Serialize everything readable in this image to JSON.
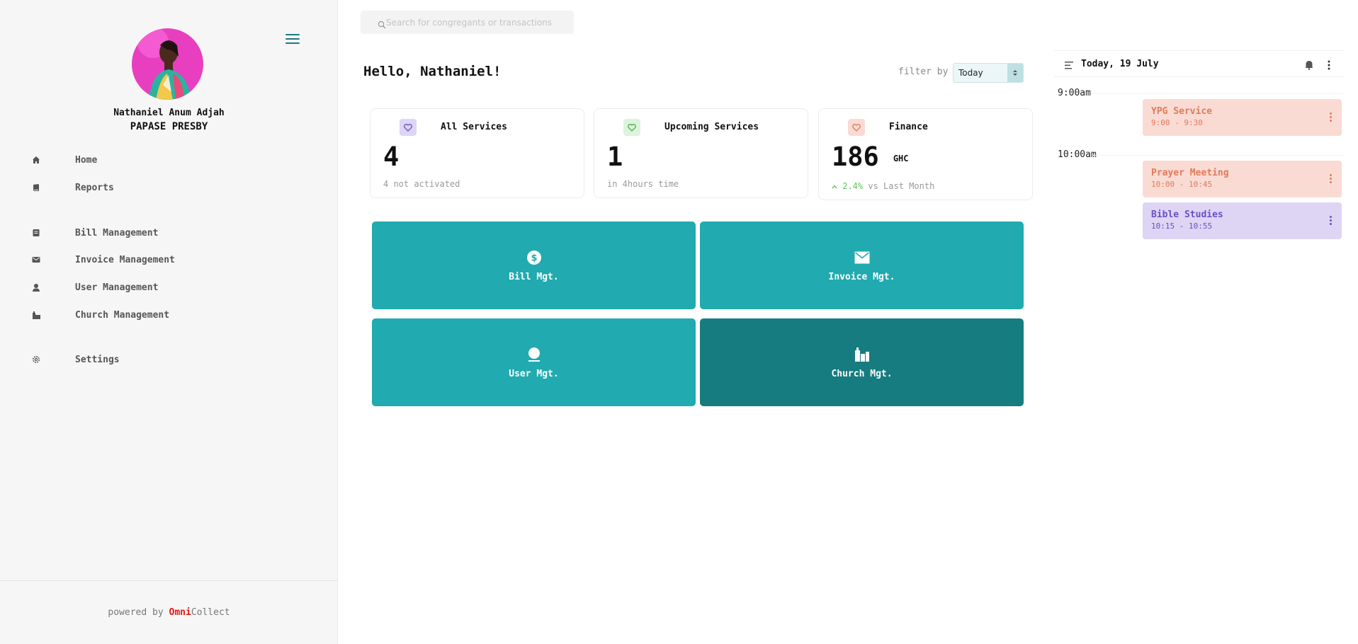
{
  "colors": {
    "accent": "#21aaaf",
    "accent_dark": "#167c80",
    "brand_red": "#e01515",
    "trend_green": "#5ac85a"
  },
  "sidebar": {
    "user_name": "Nathaniel Anum Adjah",
    "church_name": "PAPASE PRESBY",
    "items": [
      {
        "label": "Home",
        "icon": "home-icon"
      },
      {
        "label": "Reports",
        "icon": "book-icon"
      },
      {
        "label": "Bill Management",
        "icon": "bill-icon"
      },
      {
        "label": "Invoice Management",
        "icon": "mail-icon"
      },
      {
        "label": "User Management",
        "icon": "user-icon"
      },
      {
        "label": "Church Management",
        "icon": "church-icon"
      },
      {
        "label": "Settings",
        "icon": "gear-icon"
      }
    ],
    "powered_prefix": "powered by",
    "brand_omni": "Omni",
    "brand_collect": "Collect"
  },
  "search": {
    "placeholder": "Search for congregants or transactions"
  },
  "header": {
    "greeting": "Hello, Nathaniel!",
    "filter_label": "filter by",
    "filter_value": "Today"
  },
  "stats": [
    {
      "title": "All Services",
      "value": "4",
      "unit": "",
      "sub": "4 not activated",
      "trend": ""
    },
    {
      "title": "Upcoming Services",
      "value": "1",
      "unit": "",
      "sub": "in 4hours time",
      "trend": ""
    },
    {
      "title": "Finance",
      "value": "186",
      "unit": "GHC",
      "sub": "vs Last Month",
      "trend": "2.4%"
    }
  ],
  "tiles": [
    {
      "label": "Bill Mgt.",
      "icon": "dollar-icon"
    },
    {
      "label": "Invoice Mgt.",
      "icon": "mail-icon"
    },
    {
      "label": "User Mgt.",
      "icon": "user-icon"
    },
    {
      "label": "Church Mgt.",
      "icon": "church-icon"
    }
  ],
  "schedule": {
    "date": "Today, 19 July",
    "times": [
      "9:00am",
      "10:00am"
    ],
    "events": [
      {
        "title": "YPG Service",
        "time": "9:00 - 9:30"
      },
      {
        "title": "Prayer Meeting",
        "time": "10:00 - 10:45"
      },
      {
        "title": "Bible Studies",
        "time": "10:15 - 10:55"
      }
    ]
  }
}
